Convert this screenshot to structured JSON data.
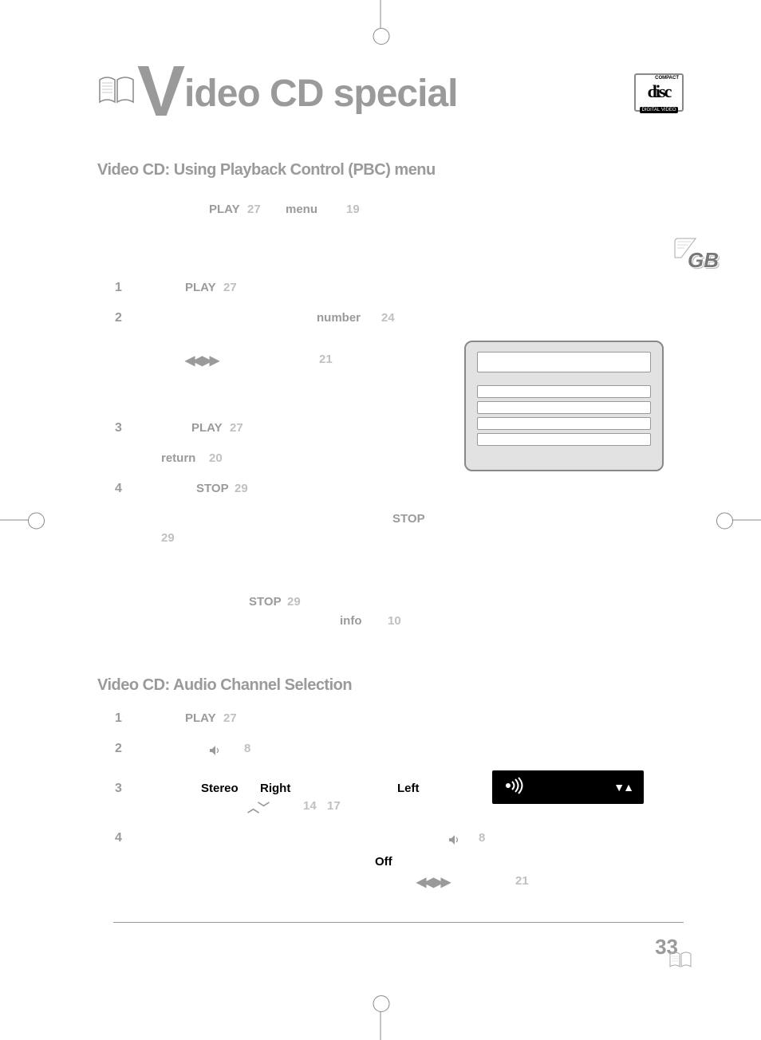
{
  "header": {
    "title_prefix": "V",
    "title_rest": "ideo CD special",
    "logo_compact": "COMPACT",
    "logo_disc": "disc",
    "logo_dv": "DIGITAL VIDEO",
    "gb": "GB"
  },
  "section1": {
    "heading": "Video CD: Using Playback Control (PBC) menu",
    "intro_play": "PLAY",
    "intro_play_num": "27",
    "intro_menu": "menu",
    "intro_menu_num": "19",
    "steps": {
      "s1_num": "1",
      "s1_play": "PLAY",
      "s1_play_num": "27",
      "s2_num": "2",
      "s2_number": "number",
      "s2_number_num": "24",
      "s2_arrows_num": "21",
      "s3_num": "3",
      "s3_play": "PLAY",
      "s3_play_num": "27",
      "s3_return": "return",
      "s3_return_num": "20",
      "s4_num": "4",
      "s4_stop": "STOP",
      "s4_stop_num": "29",
      "s4_stop2": "STOP",
      "s4_stop2_num": "29",
      "note_stop": "STOP",
      "note_stop_num": "29",
      "note_info": "info",
      "note_info_num": "10"
    }
  },
  "section2": {
    "heading": "Video CD: Audio Channel Selection",
    "steps": {
      "s1_num": "1",
      "s1_play": "PLAY",
      "s1_play_num": "27",
      "s2_num": "2",
      "s2_icon_num": "8",
      "s3_num": "3",
      "s3_stereo": "Stereo",
      "s3_right": "Right",
      "s3_left": "Left",
      "s3_updown_num": "14",
      "s3_updown_num2": "17",
      "s4_num": "4",
      "s4_icon_num": "8",
      "s4_off": "Off",
      "s4_arrows_num": "21"
    }
  },
  "footer": {
    "page_number": "33"
  },
  "infobar": {
    "tri": "▼▲"
  }
}
